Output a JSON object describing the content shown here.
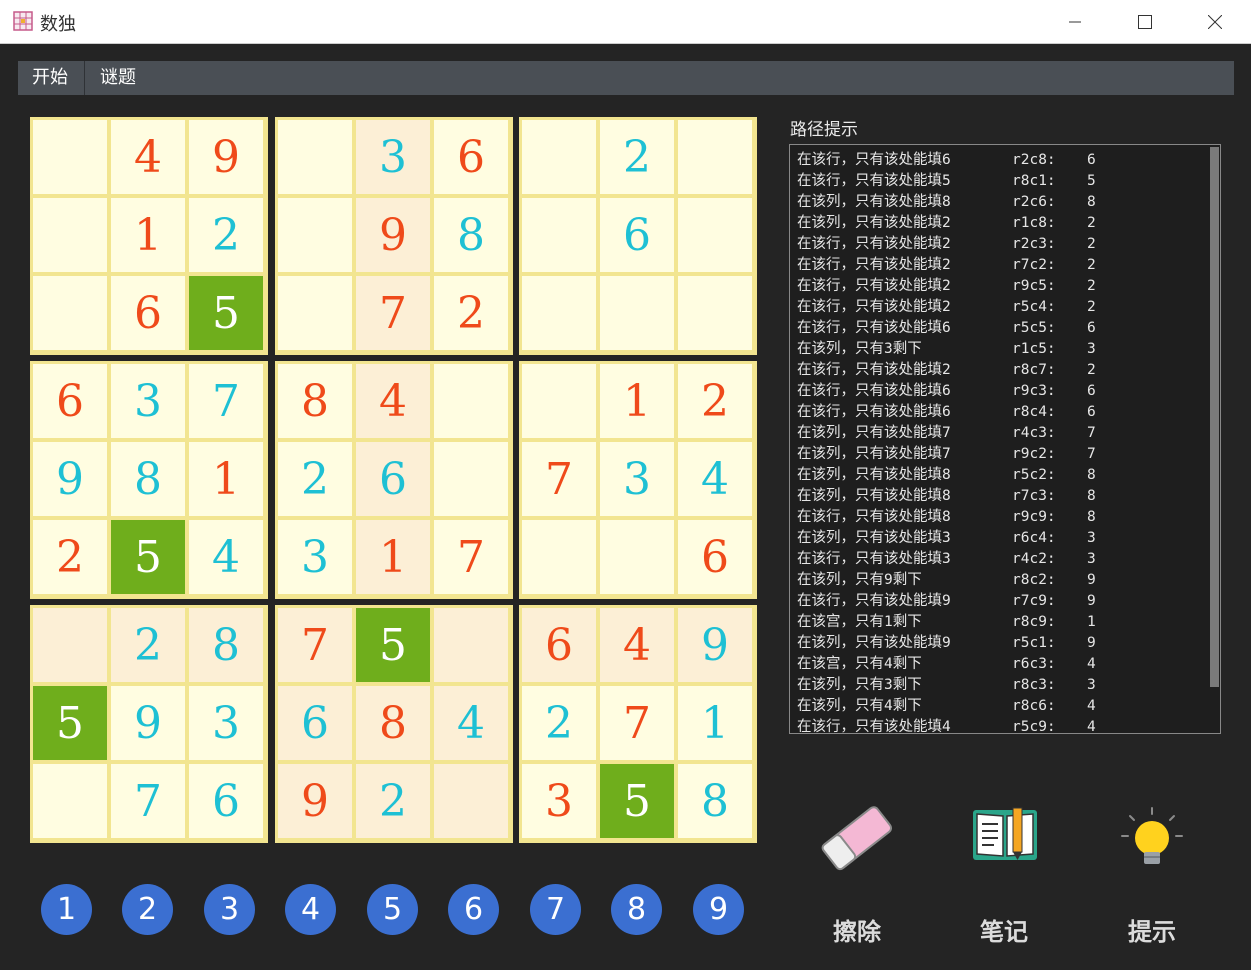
{
  "window": {
    "title": "数独"
  },
  "menu": {
    "items": [
      "开始",
      "谜题"
    ]
  },
  "board": {
    "selected_digit": "5",
    "rows": [
      [
        {
          "v": "",
          "k": ""
        },
        {
          "v": "4",
          "k": "given"
        },
        {
          "v": "9",
          "k": "given"
        },
        {
          "v": "",
          "k": ""
        },
        {
          "v": "3",
          "k": "user"
        },
        {
          "v": "6",
          "k": "given"
        },
        {
          "v": "",
          "k": ""
        },
        {
          "v": "2",
          "k": "user"
        },
        {
          "v": "",
          "k": ""
        }
      ],
      [
        {
          "v": "",
          "k": ""
        },
        {
          "v": "1",
          "k": "given"
        },
        {
          "v": "2",
          "k": "user"
        },
        {
          "v": "",
          "k": ""
        },
        {
          "v": "9",
          "k": "given"
        },
        {
          "v": "8",
          "k": "user"
        },
        {
          "v": "",
          "k": ""
        },
        {
          "v": "6",
          "k": "user"
        },
        {
          "v": "",
          "k": ""
        }
      ],
      [
        {
          "v": "",
          "k": ""
        },
        {
          "v": "6",
          "k": "given"
        },
        {
          "v": "5",
          "k": "sel"
        },
        {
          "v": "",
          "k": ""
        },
        {
          "v": "7",
          "k": "given"
        },
        {
          "v": "2",
          "k": "given"
        },
        {
          "v": "",
          "k": ""
        },
        {
          "v": "",
          "k": ""
        },
        {
          "v": "",
          "k": ""
        }
      ],
      [
        {
          "v": "6",
          "k": "given"
        },
        {
          "v": "3",
          "k": "user"
        },
        {
          "v": "7",
          "k": "user"
        },
        {
          "v": "8",
          "k": "given"
        },
        {
          "v": "4",
          "k": "given"
        },
        {
          "v": "",
          "k": ""
        },
        {
          "v": "",
          "k": ""
        },
        {
          "v": "1",
          "k": "given"
        },
        {
          "v": "2",
          "k": "given"
        }
      ],
      [
        {
          "v": "9",
          "k": "user"
        },
        {
          "v": "8",
          "k": "user"
        },
        {
          "v": "1",
          "k": "given"
        },
        {
          "v": "2",
          "k": "user"
        },
        {
          "v": "6",
          "k": "user"
        },
        {
          "v": "",
          "k": ""
        },
        {
          "v": "7",
          "k": "given"
        },
        {
          "v": "3",
          "k": "user"
        },
        {
          "v": "4",
          "k": "user"
        }
      ],
      [
        {
          "v": "2",
          "k": "given"
        },
        {
          "v": "5",
          "k": "sel"
        },
        {
          "v": "4",
          "k": "user"
        },
        {
          "v": "3",
          "k": "user"
        },
        {
          "v": "1",
          "k": "given"
        },
        {
          "v": "7",
          "k": "given"
        },
        {
          "v": "",
          "k": ""
        },
        {
          "v": "",
          "k": ""
        },
        {
          "v": "6",
          "k": "given"
        }
      ],
      [
        {
          "v": "",
          "k": ""
        },
        {
          "v": "2",
          "k": "user"
        },
        {
          "v": "8",
          "k": "user"
        },
        {
          "v": "7",
          "k": "given"
        },
        {
          "v": "5",
          "k": "sel"
        },
        {
          "v": "",
          "k": ""
        },
        {
          "v": "6",
          "k": "given"
        },
        {
          "v": "4",
          "k": "given"
        },
        {
          "v": "9",
          "k": "user"
        }
      ],
      [
        {
          "v": "5",
          "k": "sel"
        },
        {
          "v": "9",
          "k": "user"
        },
        {
          "v": "3",
          "k": "user"
        },
        {
          "v": "6",
          "k": "user"
        },
        {
          "v": "8",
          "k": "given"
        },
        {
          "v": "4",
          "k": "user"
        },
        {
          "v": "2",
          "k": "user"
        },
        {
          "v": "7",
          "k": "given"
        },
        {
          "v": "1",
          "k": "user"
        }
      ],
      [
        {
          "v": "",
          "k": ""
        },
        {
          "v": "7",
          "k": "user"
        },
        {
          "v": "6",
          "k": "user"
        },
        {
          "v": "9",
          "k": "given"
        },
        {
          "v": "2",
          "k": "user"
        },
        {
          "v": "",
          "k": ""
        },
        {
          "v": "3",
          "k": "given"
        },
        {
          "v": "5",
          "k": "sel"
        },
        {
          "v": "8",
          "k": "user"
        }
      ]
    ]
  },
  "numpad": [
    "1",
    "2",
    "3",
    "4",
    "5",
    "6",
    "7",
    "8",
    "9"
  ],
  "hints": {
    "label": "路径提示",
    "rows": [
      [
        "在该行，只有该处能填6",
        "r2c8:",
        "6"
      ],
      [
        "在该行，只有该处能填5",
        "r8c1:",
        "5"
      ],
      [
        "在该列，只有该处能填8",
        "r2c6:",
        "8"
      ],
      [
        "在该列，只有该处能填2",
        "r1c8:",
        "2"
      ],
      [
        "在该行，只有该处能填2",
        "r2c3:",
        "2"
      ],
      [
        "在该行，只有该处能填2",
        "r7c2:",
        "2"
      ],
      [
        "在该行，只有该处能填2",
        "r9c5:",
        "2"
      ],
      [
        "在该行，只有该处能填2",
        "r5c4:",
        "2"
      ],
      [
        "在该行，只有该处能填6",
        "r5c5:",
        "6"
      ],
      [
        "在该列，只有3剩下",
        "r1c5:",
        "3"
      ],
      [
        "在该行，只有该处能填2",
        "r8c7:",
        "2"
      ],
      [
        "在该行，只有该处能填6",
        "r9c3:",
        "6"
      ],
      [
        "在该行，只有该处能填6",
        "r8c4:",
        "6"
      ],
      [
        "在该列，只有该处能填7",
        "r4c3:",
        "7"
      ],
      [
        "在该列，只有该处能填7",
        "r9c2:",
        "7"
      ],
      [
        "在该列，只有该处能填8",
        "r5c2:",
        "8"
      ],
      [
        "在该列，只有该处能填8",
        "r7c3:",
        "8"
      ],
      [
        "在该行，只有该处能填8",
        "r9c9:",
        "8"
      ],
      [
        "在该列，只有该处能填3",
        "r6c4:",
        "3"
      ],
      [
        "在该行，只有该处能填3",
        "r4c2:",
        "3"
      ],
      [
        "在该列，只有9剩下",
        "r8c2:",
        "9"
      ],
      [
        "在该行，只有该处能填9",
        "r7c9:",
        "9"
      ],
      [
        "在该宫，只有1剩下",
        "r8c9:",
        "1"
      ],
      [
        "在该列，只有该处能填9",
        "r5c1:",
        "9"
      ],
      [
        "在该宫，只有4剩下",
        "r6c3:",
        "4"
      ],
      [
        "在该列，只有3剩下",
        "r8c3:",
        "3"
      ],
      [
        "在该列，只有4剩下",
        "r8c6:",
        "4"
      ],
      [
        "在该行，只有该处能填4",
        "r5c9:",
        "4"
      ]
    ]
  },
  "tools": {
    "erase": "擦除",
    "notes": "笔记",
    "hint": "提示"
  },
  "colors": {
    "given": "#ef4a1a",
    "user": "#1ec0d4",
    "selected": "#6fae1c",
    "numpad": "#3b6fd1"
  }
}
